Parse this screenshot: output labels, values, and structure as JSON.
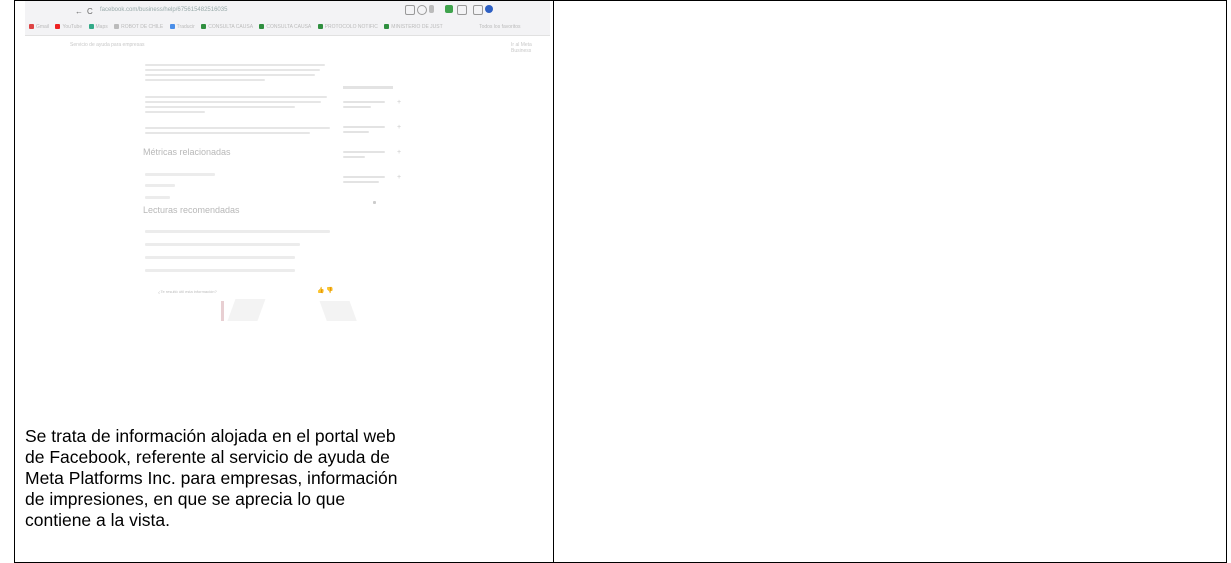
{
  "caption": {
    "lines": [
      "Se trata de información alojada en el portal web",
      "de Facebook, referente al servicio de ayuda de",
      "Meta Platforms Inc. para empresas, información",
      "de impresiones, en que se aprecia lo que",
      "contiene a la vista."
    ]
  },
  "screenshot": {
    "nav": {
      "back": "←",
      "reload": "C"
    },
    "url": "facebook.com/business/help/675615482516035",
    "bookmarks": [
      "Gmail",
      "YouTube",
      "Maps",
      "ROBOT DE CHILE",
      "Traducir",
      "CONSULTA CAUSA",
      "CONSULTA CAUSA",
      "PROTOCOLO NOTIFIC",
      "MINISTERIO DE JUST"
    ],
    "bookmarks_right": "Todos los favoritos",
    "help_header": "Servicio de ayuda para empresas",
    "help_link": "Ir al Meta Business",
    "heading_related": "Métricas relacionadas",
    "heading_reading": "Lecturas recomendadas",
    "feedback_question": "¿Te resultó útil esta información?",
    "thumbs": "👍  👎",
    "plus": "+",
    "colors": {
      "chrome": "#f3f3f5",
      "faint_text": "#e6e6e6",
      "border": "#000000"
    }
  }
}
